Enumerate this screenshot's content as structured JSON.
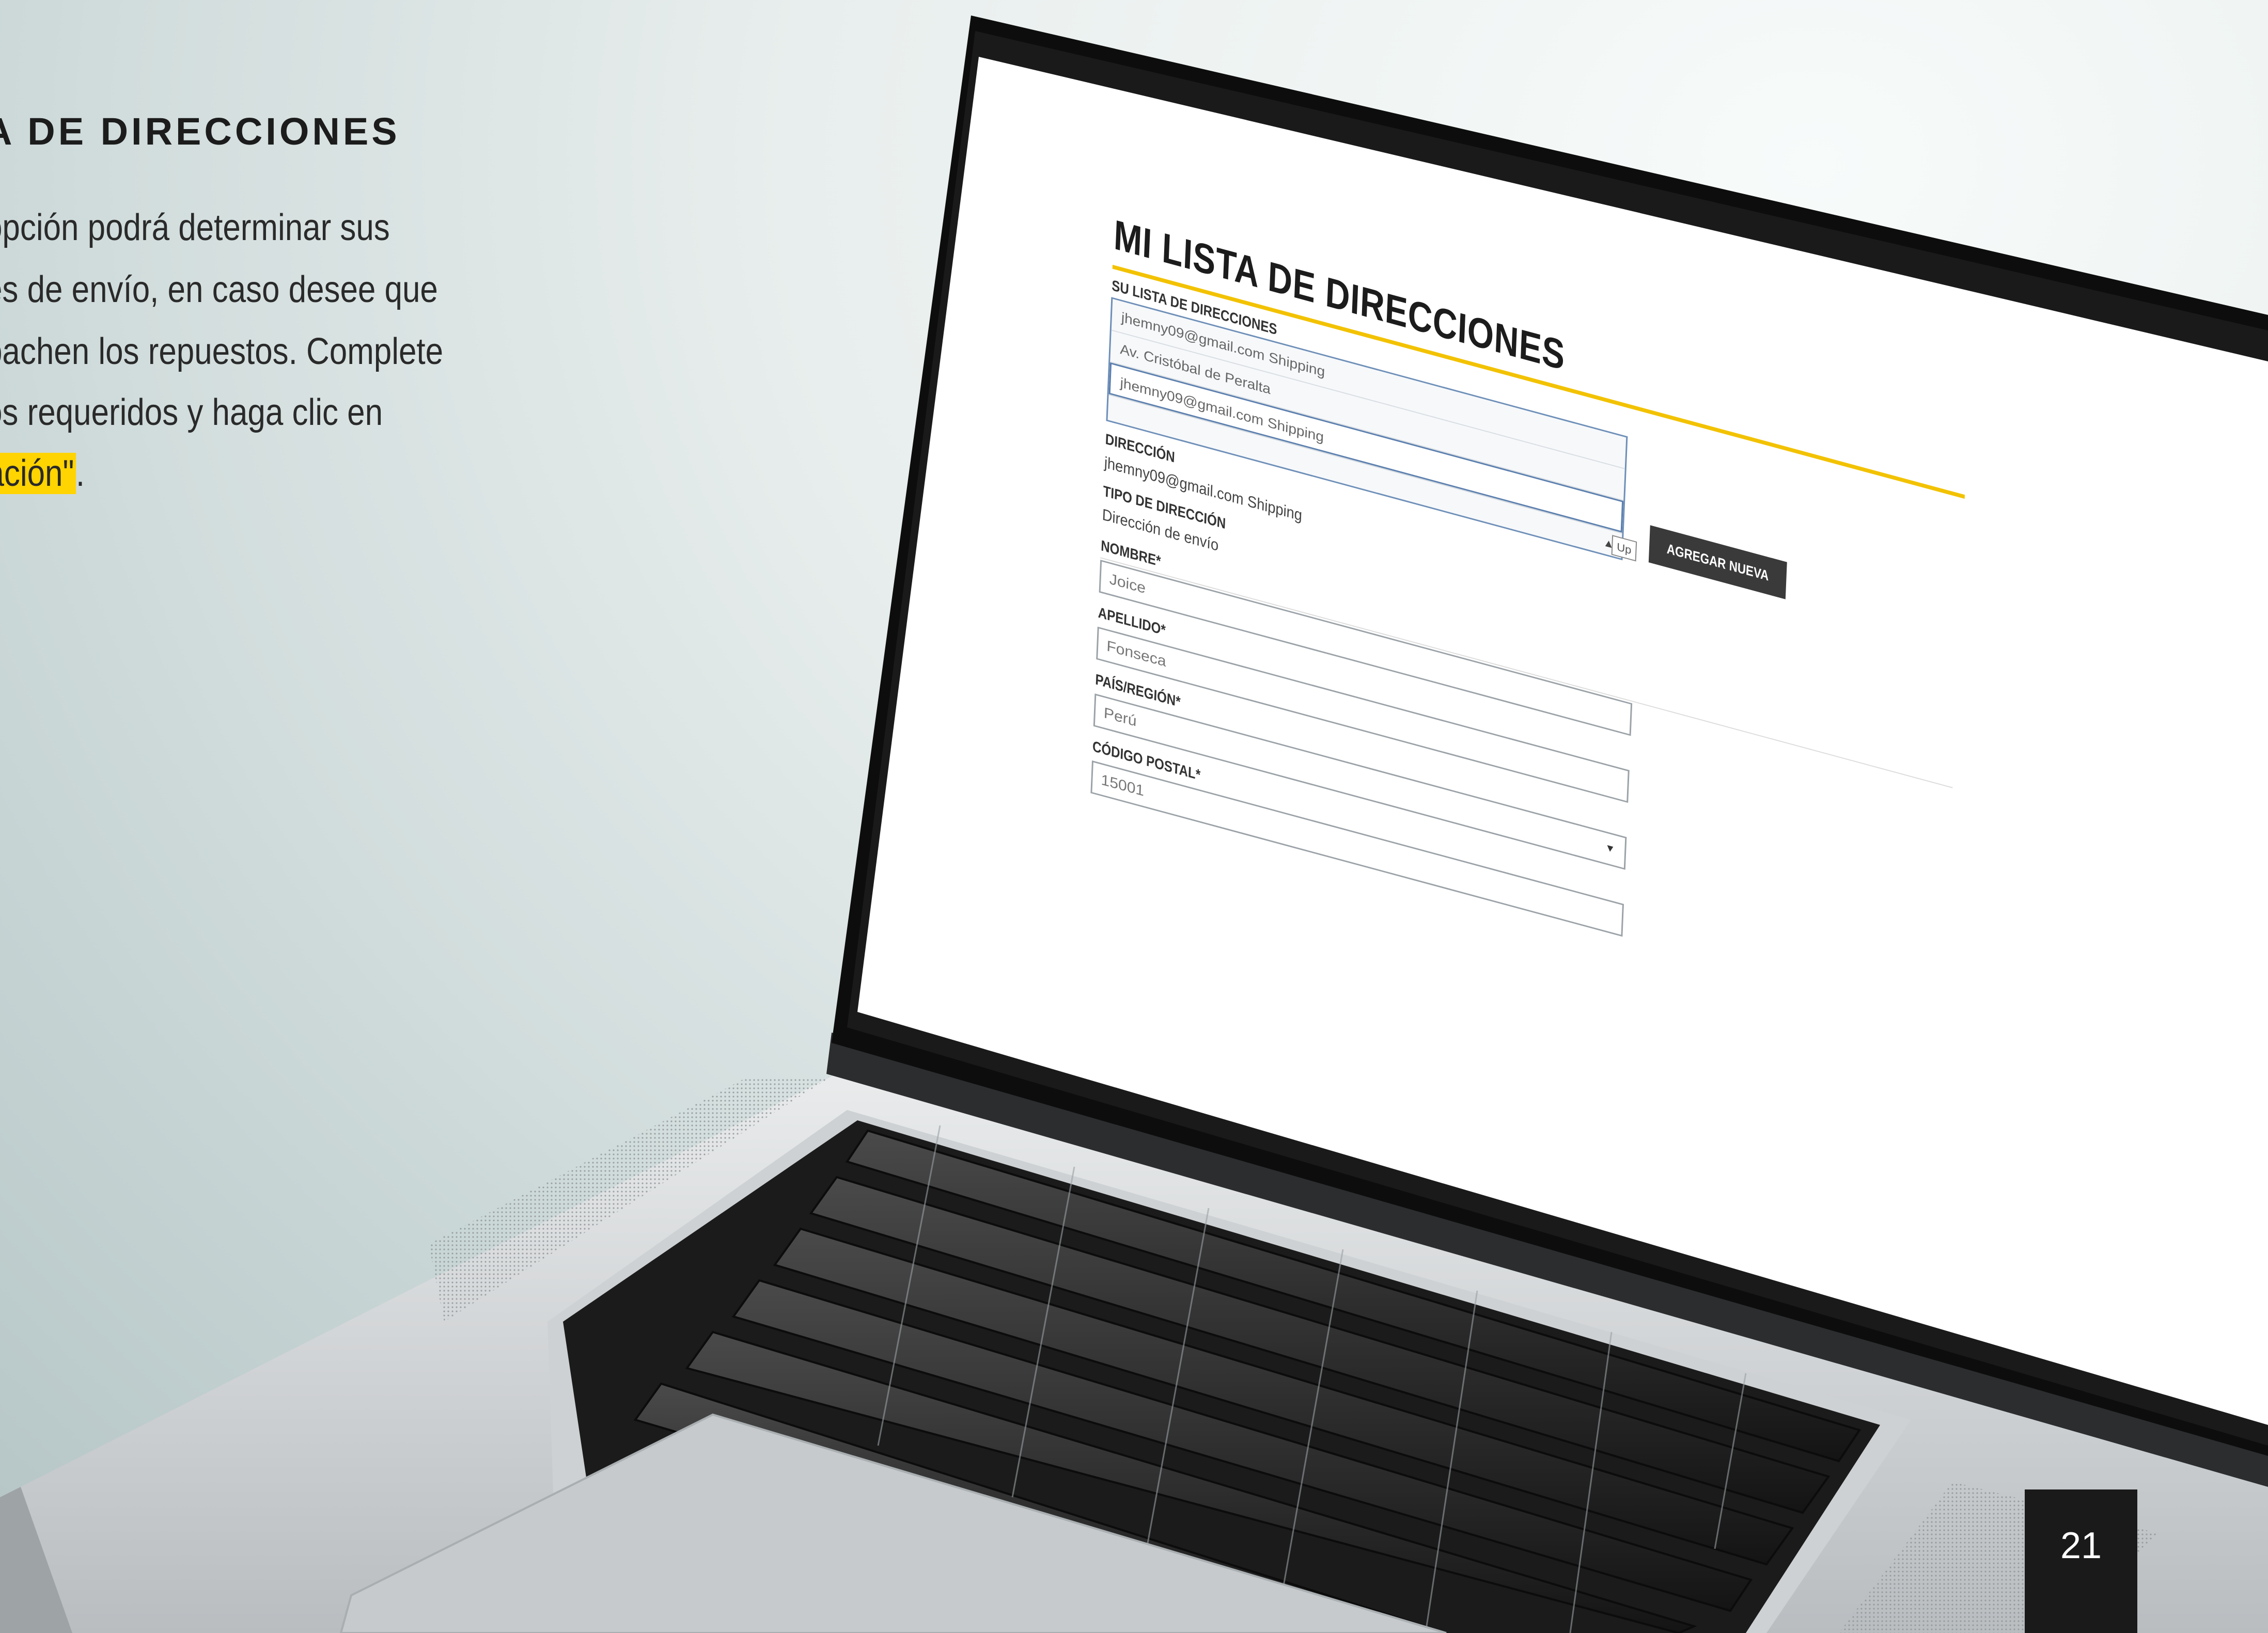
{
  "instructions": {
    "heading": "A DE DIRECCIONES",
    "lines": [
      "opción podrá determinar sus",
      "es de envío, en caso desee que",
      "pachen los repuestos. Complete",
      "os requeridos y haga clic en"
    ],
    "highlight_text": "ación\"",
    "highlight_suffix": ".",
    "highlight_color": "#ffd400"
  },
  "page_number": "21",
  "form": {
    "title": "MI LISTA DE DIRECCIONES",
    "accent_color": "#f2c200",
    "address_list_label": "SU LISTA DE DIRECCIONES",
    "address_options": [
      "jhemny09@gmail.com Shipping",
      "Av. Cristóbal de Peralta",
      "jhemny09@gmail.com Shipping"
    ],
    "up_label": "Up",
    "add_button": "AGREGAR NUEVA",
    "direccion_label": "DIRECCIÓN",
    "direccion_value": "jhemny09@gmail.com Shipping",
    "tipo_label": "TIPO DE DIRECCIÓN",
    "tipo_value": "Dirección de envío",
    "nombre_label": "NOMBRE*",
    "nombre_value": "Joice",
    "apellido_label": "APELLIDO*",
    "apellido_value": "Fonseca",
    "pais_label": "PAÍS/REGIÓN*",
    "pais_value": "Perú",
    "postal_label": "CÓDIGO POSTAL*",
    "postal_value": "15001"
  }
}
